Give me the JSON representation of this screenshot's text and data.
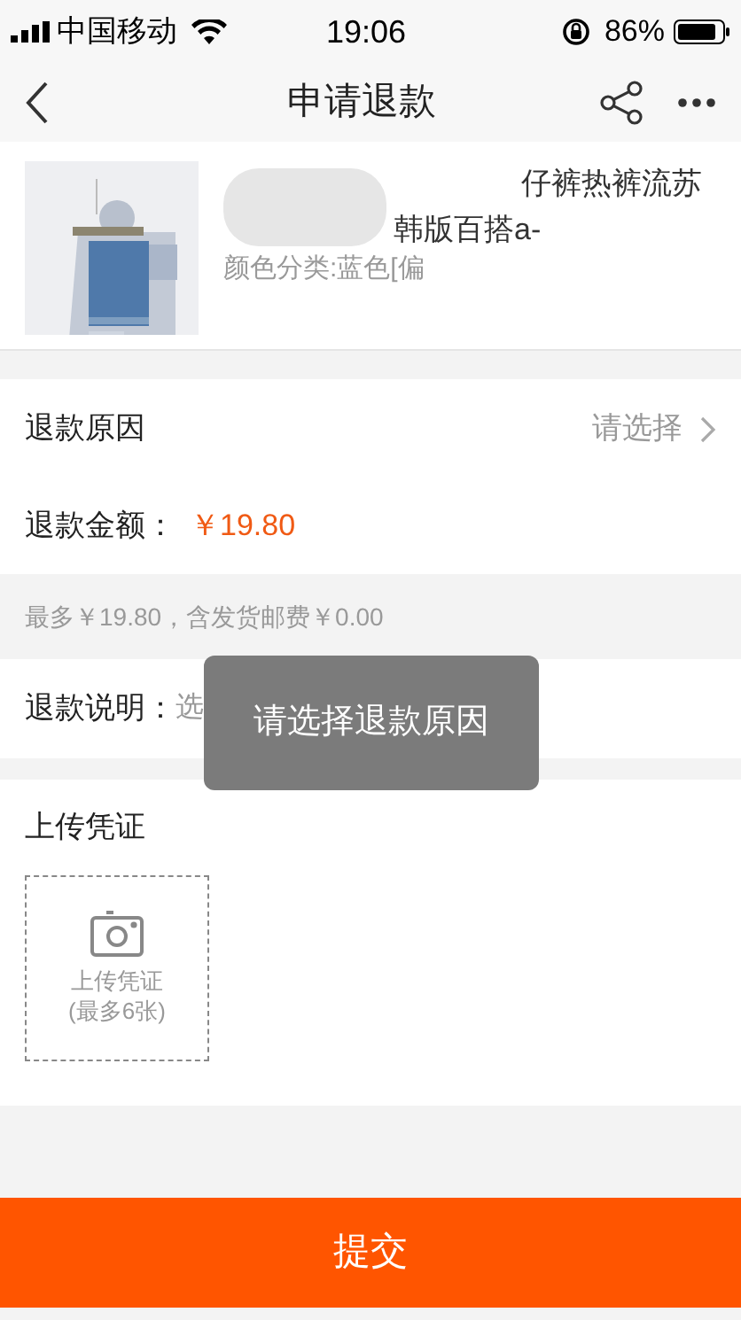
{
  "status_bar": {
    "carrier": "中国移动",
    "time": "19:06",
    "battery": "86%"
  },
  "nav": {
    "title": "申请退款"
  },
  "product": {
    "title_tail": "仔裤热裤流苏",
    "line_2_tail": "韩版百搭a-",
    "variant": "颜色分类:蓝色[偏"
  },
  "reason": {
    "label": "退款原因",
    "value": "请选择"
  },
  "amount": {
    "label": "退款金额：",
    "value": "￥19.80"
  },
  "note": "最多￥19.80，含发货邮费￥0.00",
  "description": {
    "label": "退款说明：",
    "placeholder": "选"
  },
  "upload": {
    "title": "上传凭证",
    "button_line_1": "上传凭证",
    "button_line_2": "(最多6张)"
  },
  "toast": "请选择退款原因",
  "submit": "提交"
}
